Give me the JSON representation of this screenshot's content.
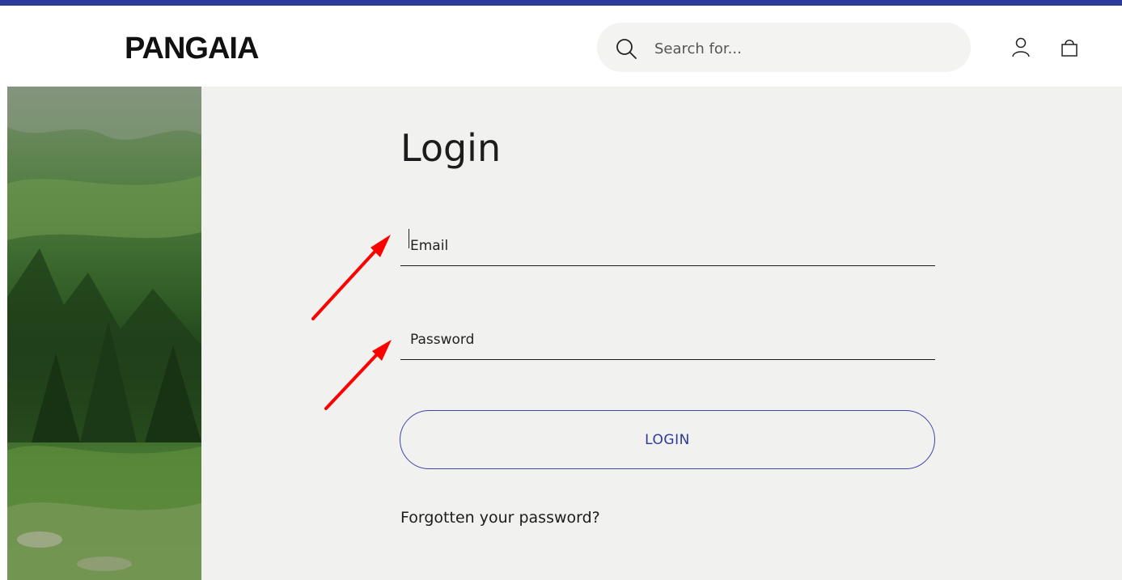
{
  "header": {
    "brand": "PANGAIA",
    "search": {
      "placeholder": "Search for..."
    },
    "icons": [
      "search-icon",
      "user-icon",
      "bag-icon"
    ]
  },
  "login": {
    "title": "Login",
    "email_placeholder": "Email",
    "password_placeholder": "Password",
    "submit_label": "LOGIN",
    "forgot_label": "Forgotten your password?"
  },
  "colors": {
    "accent": "#2c3a9a",
    "panel_bg": "#f1f1ef",
    "annotation_arrow": "#ff0000"
  }
}
